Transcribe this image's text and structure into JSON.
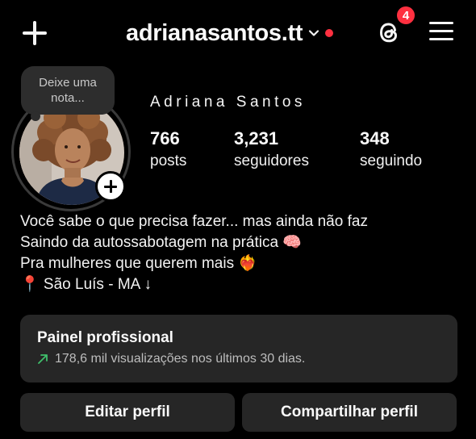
{
  "header": {
    "username": "adrianasantos.tt",
    "notification_count": "4"
  },
  "profile": {
    "note_placeholder": "Deixe uma nota...",
    "full_name": "Adriana Santos",
    "stats": [
      {
        "value": "766",
        "label": "posts"
      },
      {
        "value": "3,231",
        "label": "seguidores"
      },
      {
        "value": "348",
        "label": "seguindo"
      }
    ]
  },
  "bio": {
    "lines": [
      "Você sabe o que precisa fazer... mas ainda não faz",
      "Saindo da autossabotagem na prática 🧠",
      "Pra mulheres que querem mais ❤️‍🔥",
      "📍 São Luís - MA ↓"
    ]
  },
  "panel": {
    "title": "Painel profissional",
    "subtitle": "178,6 mil visualizações nos últimos 30 dias."
  },
  "actions": {
    "edit_label": "Editar perfil",
    "share_label": "Compartilhar perfil"
  },
  "colors": {
    "background": "#000000",
    "surface": "#262626",
    "notification_red": "#ff3040",
    "trend_green": "#3fbf6b"
  },
  "icons": [
    "plus-icon",
    "chevron-down-icon",
    "threads-icon",
    "menu-icon",
    "add-story-icon",
    "trend-up-icon"
  ]
}
